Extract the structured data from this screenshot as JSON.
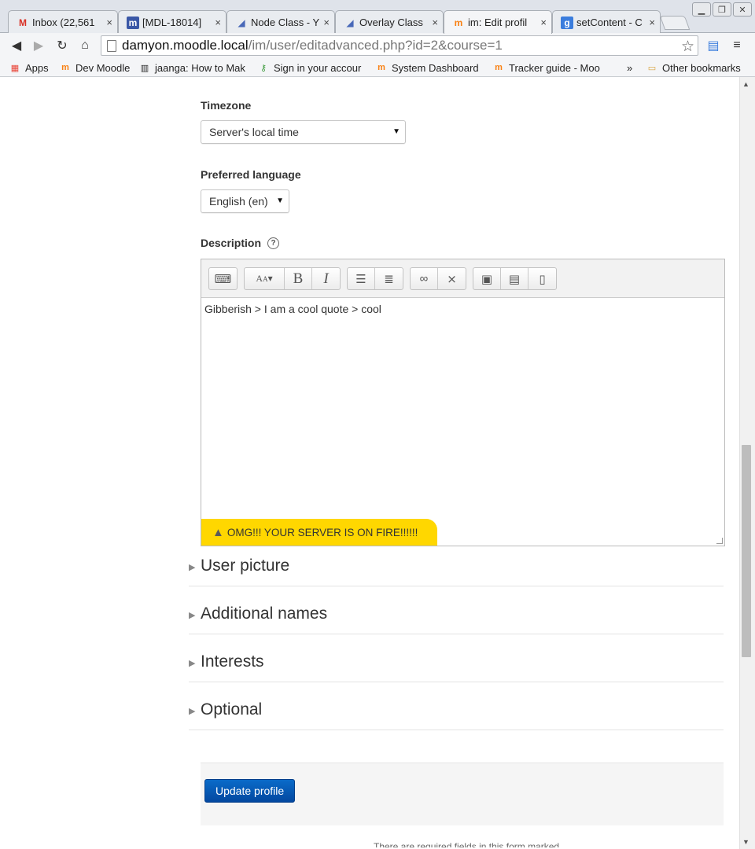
{
  "browser": {
    "tabs": [
      {
        "label": "Inbox (22,561",
        "icon": "gmail-icon",
        "icon_glyph": "M",
        "icon_color": "#d93025"
      },
      {
        "label": "[MDL-18014] ",
        "icon": "moodle-tracker-icon",
        "icon_glyph": "m",
        "icon_color": "#3a57a6"
      },
      {
        "label": "Node Class - Y",
        "icon": "yui-icon",
        "icon_glyph": "◢",
        "icon_color": "#4868b8"
      },
      {
        "label": "Overlay Class",
        "icon": "yui-icon",
        "icon_glyph": "◢",
        "icon_color": "#4868b8"
      },
      {
        "label": "im: Edit profil",
        "icon": "moodle-icon",
        "icon_glyph": "m",
        "icon_color": "#f98012"
      },
      {
        "label": "setContent - C",
        "icon": "google-icon",
        "icon_glyph": "g",
        "icon_color": "#3b7ddd"
      }
    ],
    "tab_close_glyph": "×",
    "address": {
      "host": "damyon.moodle.local",
      "path": "/im/user/editadvanced.php?id=2&course=1"
    },
    "bookmarks": [
      {
        "label": "Apps",
        "icon": "apps-grid-icon"
      },
      {
        "label": "Dev Moodle",
        "icon": "moodle-icon"
      },
      {
        "label": "jaanga: How to Mak",
        "icon": "barcode-icon"
      },
      {
        "label": "Sign in your accour",
        "icon": "key-icon"
      },
      {
        "label": "System Dashboard",
        "icon": "moodle-icon"
      },
      {
        "label": "Tracker guide - Moo",
        "icon": "moodle-icon"
      }
    ],
    "bookmarks_overflow": "»",
    "other_bookmarks": "Other bookmarks"
  },
  "form": {
    "timezone": {
      "label": "Timezone",
      "value": "Server's local time"
    },
    "language": {
      "label": "Preferred language",
      "value": "English (en)"
    },
    "description": {
      "label": "Description",
      "help_glyph": "?",
      "content": "Gibberish > I am a cool quote > cool",
      "warning": "OMG!!! YOUR SERVER IS ON FIRE!!!!!!",
      "warning_color": "#ffd700"
    },
    "sections": [
      "User picture",
      "Additional names",
      "Interests",
      "Optional"
    ],
    "submit_label": "Update profile",
    "submit_color": "#0a5fb4",
    "footnote": "There are required fields in this form marked"
  }
}
